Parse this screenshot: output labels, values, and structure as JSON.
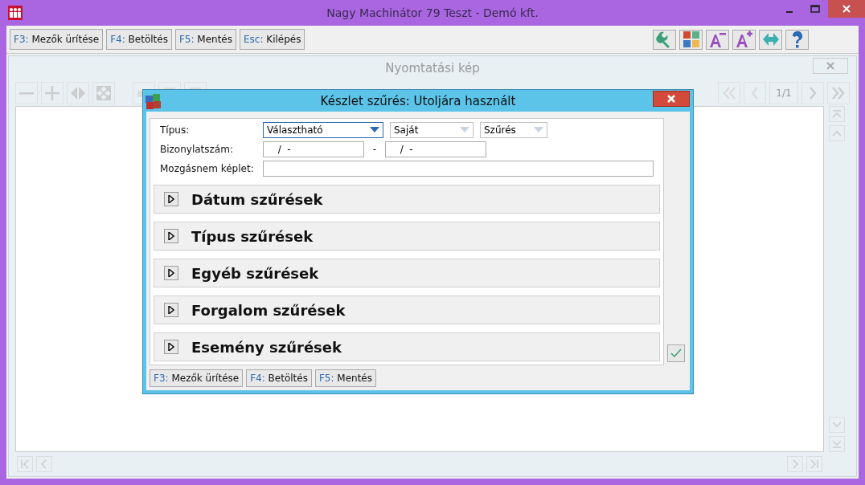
{
  "window": {
    "title": "Nagy Machinátor 79 Teszt - Demó kft."
  },
  "toolbar": {
    "buttons": [
      {
        "key": "F3:",
        "label": "Mezők ürítése"
      },
      {
        "key": "F4:",
        "label": "Betöltés"
      },
      {
        "key": "F5:",
        "label": "Mentés"
      },
      {
        "key": "Esc:",
        "label": "Kilépés"
      }
    ]
  },
  "preview": {
    "title": "Nyomtatási kép",
    "page_indicator": "1/1"
  },
  "dialog": {
    "title": "Készlet szűrés: Utoljára használt",
    "type_label": "Típus:",
    "type_selects": [
      {
        "value": "Választható",
        "disabled": false
      },
      {
        "value": "Saját",
        "disabled": true
      },
      {
        "value": "Szűrés",
        "disabled": true
      }
    ],
    "number_label": "Bizonylatszám:",
    "number_from": "  /  -",
    "number_separator": "-",
    "number_to": "  /  -",
    "formula_label": "Mozgásnem képlet:",
    "sections": [
      {
        "label": "Dátum szűrések",
        "expanded": false
      },
      {
        "label": "Típus szűrések",
        "expanded": false
      },
      {
        "label": "Egyéb szűrések",
        "expanded": false
      },
      {
        "label": "Forgalom szűrések",
        "expanded": false
      },
      {
        "label": "Esemény szűrések",
        "expanded": false
      }
    ],
    "buttons": [
      {
        "key": "F3:",
        "label": "Mezők ürítése"
      },
      {
        "key": "F4:",
        "label": "Betöltés"
      },
      {
        "key": "F5:",
        "label": "Mentés"
      }
    ]
  }
}
